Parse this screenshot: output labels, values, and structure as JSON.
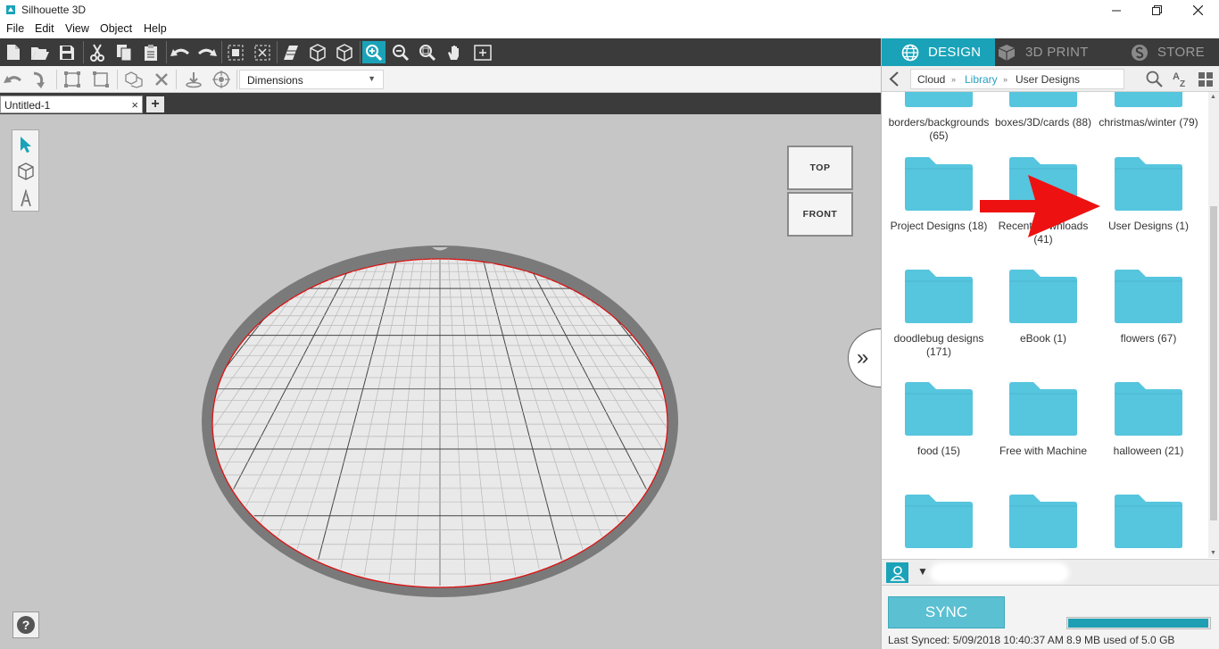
{
  "window": {
    "title": "Silhouette 3D"
  },
  "menu": [
    "File",
    "Edit",
    "View",
    "Object",
    "Help"
  ],
  "toolbar2": {
    "dimensions_label": "Dimensions"
  },
  "document": {
    "tab_label": "Untitled-1"
  },
  "viewcube": {
    "top": "TOP",
    "front": "FRONT"
  },
  "right_tabs": [
    {
      "label": "DESIGN",
      "active": true,
      "icon": "globe-icon"
    },
    {
      "label": "3D PRINT",
      "active": false,
      "icon": "cube-icon"
    },
    {
      "label": "STORE",
      "active": false,
      "icon": "store-icon"
    }
  ],
  "breadcrumb": {
    "cloud": "Cloud",
    "library": "Library",
    "current": "User Designs"
  },
  "folders": [
    {
      "label": "borders/backgrounds (65)",
      "partial": true
    },
    {
      "label": "boxes/3D/cards (88)",
      "partial": true
    },
    {
      "label": "christmas/winter (79)",
      "partial": true
    },
    {
      "label": "Project Designs (18)"
    },
    {
      "label": "Recent Downloads (41)"
    },
    {
      "label": "User Designs (1)"
    },
    {
      "label": "doodlebug designs (171)"
    },
    {
      "label": "eBook (1)"
    },
    {
      "label": "flowers (67)"
    },
    {
      "label": "food (15)"
    },
    {
      "label": "Free with Machine"
    },
    {
      "label": "halloween (21)"
    },
    {
      "label": ""
    },
    {
      "label": ""
    },
    {
      "label": ""
    }
  ],
  "sync": {
    "button": "SYNC",
    "last_synced": "Last Synced: 5/09/2018 10:40:37 AM",
    "storage": "8.9 MB used of 5.0 GB",
    "storage_fraction": 0.98
  },
  "colors": {
    "accent": "#1aa3b8",
    "folder": "#56c5de",
    "annotation_arrow": "#ee1111",
    "plate_outline": "#dd1111"
  }
}
